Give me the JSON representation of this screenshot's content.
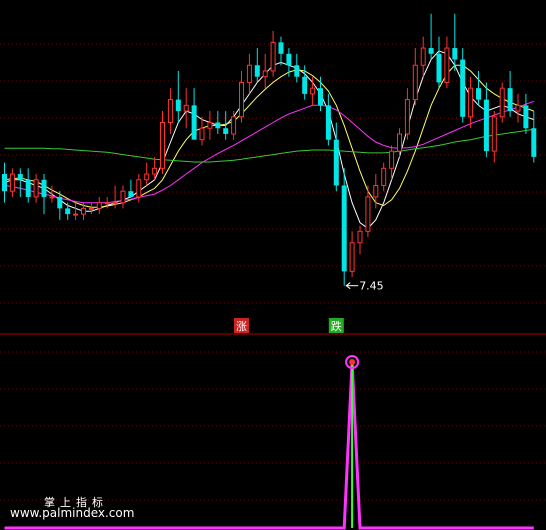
{
  "watermark": {
    "title": "掌上指标",
    "url": "www.palmindex.com"
  },
  "price_annotation": "7.45",
  "signals": {
    "rise_label": "涨",
    "fall_label": "跌"
  },
  "colors": {
    "background": "#000000",
    "grid": "#7a0000",
    "separator": "#b00000",
    "up_candle": "#ff3232",
    "down_candle": "#00e6e6",
    "ma_short": "#ffffff",
    "ma_mid": "#ffff66",
    "ma_long": "#ff33ff",
    "ma_very_long": "#33cc33",
    "indicator_spike": "#ff33ff",
    "indicator_core": "#33ff33",
    "rise_box": "#cc2222",
    "fall_box": "#22aa22"
  },
  "chart_data": [
    {
      "type": "candlestick",
      "title": "",
      "xlabel": "",
      "ylabel": "",
      "ylim": [
        7.2,
        12.3
      ],
      "grid": true,
      "low_marker": {
        "label": "7.45",
        "value": 7.45
      },
      "candles": [
        {
          "o": 9.4,
          "h": 9.6,
          "l": 8.9,
          "c": 9.1
        },
        {
          "o": 9.1,
          "h": 9.5,
          "l": 9.0,
          "c": 9.4
        },
        {
          "o": 9.4,
          "h": 9.5,
          "l": 9.0,
          "c": 9.3
        },
        {
          "o": 9.3,
          "h": 9.5,
          "l": 8.9,
          "c": 9.0
        },
        {
          "o": 9.0,
          "h": 9.4,
          "l": 8.9,
          "c": 9.3
        },
        {
          "o": 9.3,
          "h": 9.4,
          "l": 8.7,
          "c": 9.0
        },
        {
          "o": 9.0,
          "h": 9.2,
          "l": 8.9,
          "c": 9.0
        },
        {
          "o": 9.0,
          "h": 9.1,
          "l": 8.6,
          "c": 8.8
        },
        {
          "o": 8.8,
          "h": 8.9,
          "l": 8.6,
          "c": 8.7
        },
        {
          "o": 8.7,
          "h": 8.9,
          "l": 8.6,
          "c": 8.7
        },
        {
          "o": 8.7,
          "h": 8.9,
          "l": 8.6,
          "c": 8.8
        },
        {
          "o": 8.8,
          "h": 8.9,
          "l": 8.7,
          "c": 8.8
        },
        {
          "o": 8.8,
          "h": 9.0,
          "l": 8.7,
          "c": 8.9
        },
        {
          "o": 8.9,
          "h": 9.0,
          "l": 8.8,
          "c": 8.9
        },
        {
          "o": 8.9,
          "h": 9.2,
          "l": 8.8,
          "c": 8.9
        },
        {
          "o": 8.9,
          "h": 9.2,
          "l": 8.8,
          "c": 9.1
        },
        {
          "o": 9.1,
          "h": 9.3,
          "l": 9.0,
          "c": 9.0
        },
        {
          "o": 9.0,
          "h": 9.4,
          "l": 8.9,
          "c": 9.3
        },
        {
          "o": 9.3,
          "h": 9.6,
          "l": 9.2,
          "c": 9.4
        },
        {
          "o": 9.4,
          "h": 9.7,
          "l": 9.3,
          "c": 9.5
        },
        {
          "o": 9.5,
          "h": 10.5,
          "l": 9.4,
          "c": 10.3
        },
        {
          "o": 10.3,
          "h": 10.9,
          "l": 10.1,
          "c": 10.7
        },
        {
          "o": 10.7,
          "h": 11.2,
          "l": 10.3,
          "c": 10.5
        },
        {
          "o": 10.5,
          "h": 10.9,
          "l": 10.2,
          "c": 10.6
        },
        {
          "o": 10.6,
          "h": 10.9,
          "l": 10.0,
          "c": 10.0
        },
        {
          "o": 10.0,
          "h": 10.4,
          "l": 9.9,
          "c": 10.2
        },
        {
          "o": 10.2,
          "h": 10.5,
          "l": 10.0,
          "c": 10.3
        },
        {
          "o": 10.3,
          "h": 10.5,
          "l": 10.1,
          "c": 10.2
        },
        {
          "o": 10.2,
          "h": 10.5,
          "l": 10.0,
          "c": 10.1
        },
        {
          "o": 10.1,
          "h": 10.5,
          "l": 10.0,
          "c": 10.4
        },
        {
          "o": 10.4,
          "h": 11.2,
          "l": 10.3,
          "c": 11.0
        },
        {
          "o": 11.0,
          "h": 11.5,
          "l": 10.8,
          "c": 11.3
        },
        {
          "o": 11.3,
          "h": 11.6,
          "l": 11.0,
          "c": 11.1
        },
        {
          "o": 11.1,
          "h": 11.5,
          "l": 10.9,
          "c": 11.2
        },
        {
          "o": 11.2,
          "h": 11.9,
          "l": 11.1,
          "c": 11.7
        },
        {
          "o": 11.7,
          "h": 11.8,
          "l": 11.3,
          "c": 11.5
        },
        {
          "o": 11.5,
          "h": 11.6,
          "l": 11.1,
          "c": 11.3
        },
        {
          "o": 11.3,
          "h": 11.5,
          "l": 11.0,
          "c": 11.1
        },
        {
          "o": 11.1,
          "h": 11.3,
          "l": 10.7,
          "c": 10.8
        },
        {
          "o": 10.8,
          "h": 11.1,
          "l": 10.6,
          "c": 10.9
        },
        {
          "o": 10.9,
          "h": 11.1,
          "l": 10.5,
          "c": 10.6
        },
        {
          "o": 10.6,
          "h": 10.8,
          "l": 9.9,
          "c": 10.0
        },
        {
          "o": 10.0,
          "h": 10.3,
          "l": 9.1,
          "c": 9.2
        },
        {
          "o": 9.2,
          "h": 9.5,
          "l": 7.45,
          "c": 7.7
        },
        {
          "o": 7.7,
          "h": 8.4,
          "l": 7.6,
          "c": 8.2
        },
        {
          "o": 8.2,
          "h": 8.5,
          "l": 8.0,
          "c": 8.4
        },
        {
          "o": 8.4,
          "h": 9.2,
          "l": 8.3,
          "c": 9.0
        },
        {
          "o": 9.0,
          "h": 9.4,
          "l": 8.8,
          "c": 9.2
        },
        {
          "o": 9.2,
          "h": 9.6,
          "l": 9.1,
          "c": 9.5
        },
        {
          "o": 9.5,
          "h": 9.9,
          "l": 9.3,
          "c": 9.8
        },
        {
          "o": 9.8,
          "h": 10.2,
          "l": 9.7,
          "c": 10.1
        },
        {
          "o": 10.1,
          "h": 10.9,
          "l": 10.0,
          "c": 10.7
        },
        {
          "o": 10.7,
          "h": 11.6,
          "l": 10.6,
          "c": 11.3
        },
        {
          "o": 11.3,
          "h": 11.8,
          "l": 11.1,
          "c": 11.6
        },
        {
          "o": 11.6,
          "h": 12.2,
          "l": 11.4,
          "c": 11.5
        },
        {
          "o": 11.5,
          "h": 11.8,
          "l": 10.9,
          "c": 11.0
        },
        {
          "o": 11.0,
          "h": 11.8,
          "l": 10.9,
          "c": 11.6
        },
        {
          "o": 11.6,
          "h": 12.2,
          "l": 11.2,
          "c": 11.4
        },
        {
          "o": 11.4,
          "h": 11.6,
          "l": 10.3,
          "c": 10.4
        },
        {
          "o": 10.4,
          "h": 11.1,
          "l": 10.2,
          "c": 10.9
        },
        {
          "o": 10.9,
          "h": 11.2,
          "l": 10.6,
          "c": 10.7
        },
        {
          "o": 10.7,
          "h": 11.0,
          "l": 9.7,
          "c": 9.8
        },
        {
          "o": 9.8,
          "h": 10.5,
          "l": 9.6,
          "c": 10.4
        },
        {
          "o": 10.4,
          "h": 11.0,
          "l": 10.3,
          "c": 10.9
        },
        {
          "o": 10.9,
          "h": 11.2,
          "l": 10.4,
          "c": 10.5
        },
        {
          "o": 10.5,
          "h": 10.8,
          "l": 10.3,
          "c": 10.6
        },
        {
          "o": 10.6,
          "h": 10.8,
          "l": 10.1,
          "c": 10.2
        },
        {
          "o": 10.2,
          "h": 10.5,
          "l": 9.6,
          "c": 9.7
        }
      ],
      "moving_averages": [
        {
          "color": "#ffffff",
          "values": [
            9.25,
            9.3,
            9.3,
            9.25,
            9.2,
            9.15,
            9.05,
            8.95,
            8.85,
            8.8,
            8.75,
            8.75,
            8.8,
            8.85,
            8.9,
            8.95,
            9.0,
            9.1,
            9.2,
            9.3,
            9.6,
            9.95,
            10.3,
            10.5,
            10.45,
            10.35,
            10.3,
            10.25,
            10.25,
            10.4,
            10.6,
            10.8,
            11.0,
            11.15,
            11.3,
            11.35,
            11.3,
            11.25,
            11.15,
            11.0,
            10.8,
            10.5,
            10.0,
            9.4,
            8.9,
            8.55,
            8.45,
            8.6,
            8.9,
            9.3,
            9.7,
            10.2,
            10.7,
            11.1,
            11.4,
            11.55,
            11.5,
            11.3,
            11.0,
            10.75,
            10.6,
            10.5,
            10.55,
            10.6,
            10.55,
            10.45,
            10.4,
            10.35
          ]
        },
        {
          "color": "#ffff66",
          "values": [
            9.3,
            9.32,
            9.33,
            9.3,
            9.27,
            9.2,
            9.12,
            9.05,
            8.97,
            8.9,
            8.85,
            8.82,
            8.82,
            8.84,
            8.87,
            8.9,
            8.95,
            9.0,
            9.08,
            9.15,
            9.3,
            9.55,
            9.8,
            10.0,
            10.15,
            10.2,
            10.25,
            10.25,
            10.27,
            10.32,
            10.45,
            10.6,
            10.75,
            10.88,
            11.0,
            11.1,
            11.18,
            11.22,
            11.2,
            11.12,
            11.0,
            10.85,
            10.6,
            10.25,
            9.85,
            9.45,
            9.1,
            8.9,
            8.85,
            8.95,
            9.15,
            9.45,
            9.8,
            10.2,
            10.6,
            10.9,
            11.15,
            11.3,
            11.3,
            11.2,
            11.05,
            10.9,
            10.8,
            10.72,
            10.65,
            10.6,
            10.55,
            10.5
          ]
        },
        {
          "color": "#ff33ff",
          "values": [
            9.2,
            9.18,
            9.15,
            9.12,
            9.08,
            9.05,
            9.02,
            8.98,
            8.95,
            8.92,
            8.9,
            8.9,
            8.9,
            8.9,
            8.92,
            8.94,
            8.96,
            8.99,
            9.02,
            9.05,
            9.12,
            9.2,
            9.3,
            9.4,
            9.5,
            9.6,
            9.68,
            9.76,
            9.83,
            9.9,
            9.98,
            10.06,
            10.14,
            10.22,
            10.3,
            10.38,
            10.45,
            10.5,
            10.55,
            10.6,
            10.6,
            10.58,
            10.52,
            10.42,
            10.3,
            10.18,
            10.06,
            9.96,
            9.9,
            9.86,
            9.85,
            9.86,
            9.88,
            9.92,
            9.98,
            10.04,
            10.1,
            10.16,
            10.22,
            10.28,
            10.33,
            10.38,
            10.43,
            10.48,
            10.52,
            10.57,
            10.62,
            10.67
          ]
        },
        {
          "color": "#33cc33",
          "values": [
            9.85,
            9.85,
            9.85,
            9.85,
            9.85,
            9.85,
            9.84,
            9.84,
            9.83,
            9.82,
            9.81,
            9.8,
            9.79,
            9.78,
            9.76,
            9.74,
            9.72,
            9.7,
            9.68,
            9.66,
            9.65,
            9.64,
            9.63,
            9.62,
            9.61,
            9.61,
            9.61,
            9.62,
            9.63,
            9.64,
            9.66,
            9.68,
            9.7,
            9.72,
            9.74,
            9.76,
            9.78,
            9.8,
            9.81,
            9.82,
            9.82,
            9.82,
            9.81,
            9.8,
            9.79,
            9.78,
            9.77,
            9.77,
            9.77,
            9.78,
            9.8,
            9.82,
            9.84,
            9.86,
            9.88,
            9.9,
            9.93,
            9.96,
            9.98,
            10.0,
            10.03,
            10.06,
            10.08,
            10.1,
            10.12,
            10.14,
            10.16,
            10.18
          ]
        }
      ],
      "signals": [
        {
          "label": "涨",
          "bar": 30
        },
        {
          "label": "跌",
          "bar": 42
        }
      ]
    },
    {
      "type": "line",
      "title": "",
      "xlabel": "",
      "ylabel": "",
      "ylim": [
        0,
        1
      ],
      "grid": true,
      "series": [
        {
          "color": "#ff33ff",
          "values": [
            0,
            0,
            0,
            0,
            0,
            0,
            0,
            0,
            0,
            0,
            0,
            0,
            0,
            0,
            0,
            0,
            0,
            0,
            0,
            0,
            0,
            0,
            0,
            0,
            0,
            0,
            0,
            0,
            0,
            0,
            0,
            0,
            0,
            0,
            0,
            0,
            0,
            0,
            0,
            0,
            0,
            0,
            0,
            0,
            1,
            0,
            0,
            0,
            0,
            0,
            0,
            0,
            0,
            0,
            0,
            0,
            0,
            0,
            0,
            0,
            0,
            0,
            0,
            0,
            0,
            0,
            0,
            0
          ]
        }
      ],
      "peak_bar": 44
    }
  ]
}
